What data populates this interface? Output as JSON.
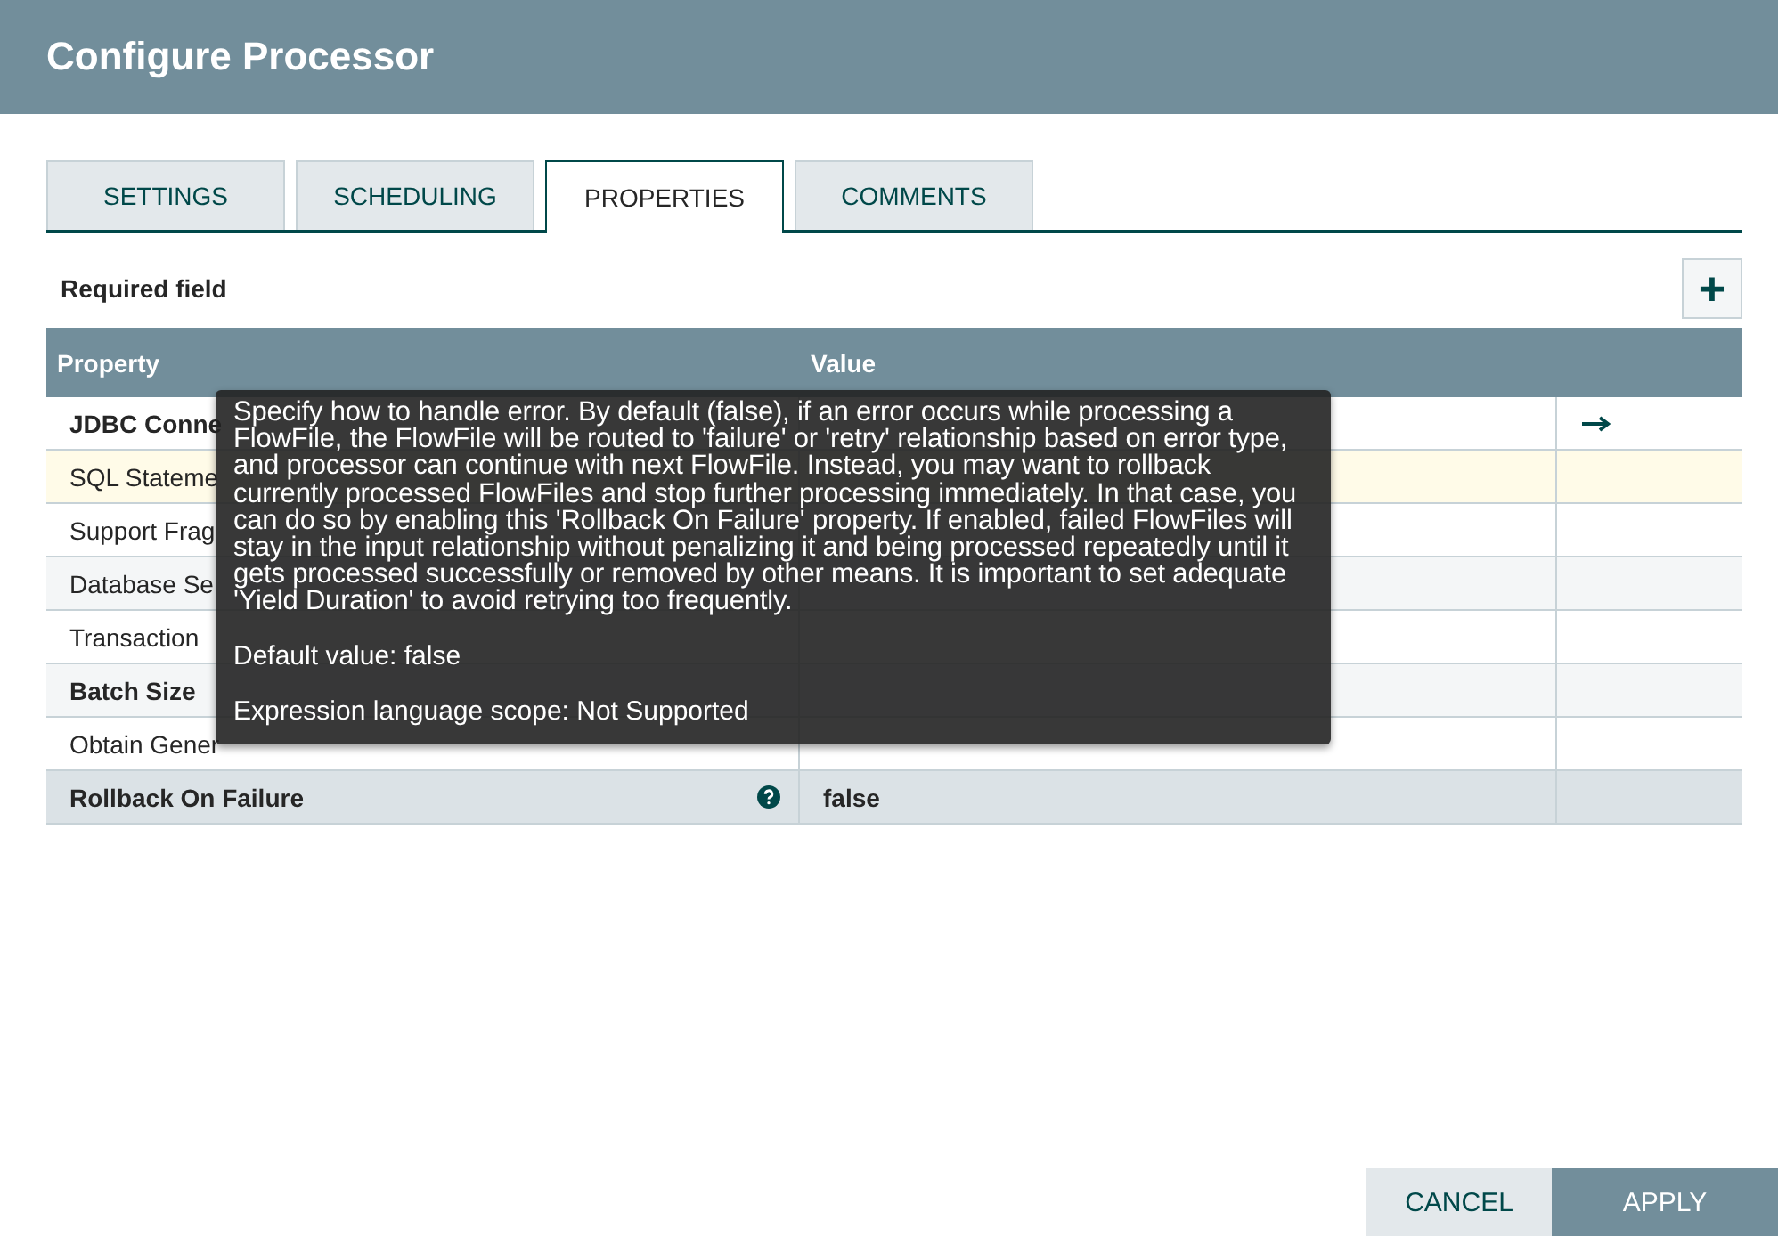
{
  "dialog": {
    "title": "Configure Processor"
  },
  "tabs": [
    {
      "label": "SETTINGS",
      "selected": false
    },
    {
      "label": "SCHEDULING",
      "selected": false
    },
    {
      "label": "PROPERTIES",
      "selected": true
    },
    {
      "label": "COMMENTS",
      "selected": false
    }
  ],
  "required_note": "Required field",
  "add_button": {
    "label": "+"
  },
  "table": {
    "columns": [
      "Property",
      "Value"
    ],
    "rows": [
      {
        "property": "JDBC Conne",
        "value": "",
        "required": true,
        "selected": false,
        "hovered": false,
        "help_icon": false,
        "goto_arrow": true
      },
      {
        "property": "SQL Stateme",
        "value": "",
        "required": false,
        "selected": true,
        "hovered": false,
        "help_icon": false,
        "goto_arrow": false
      },
      {
        "property": "Support Frag",
        "value": "",
        "required": false,
        "selected": false,
        "hovered": false,
        "help_icon": false,
        "goto_arrow": false
      },
      {
        "property": "Database Se",
        "value": "",
        "required": false,
        "selected": false,
        "hovered": false,
        "help_icon": false,
        "goto_arrow": false
      },
      {
        "property": "Transaction",
        "value": "",
        "required": false,
        "selected": false,
        "hovered": false,
        "help_icon": false,
        "goto_arrow": false
      },
      {
        "property": "Batch Size",
        "value": "",
        "required": true,
        "selected": false,
        "hovered": false,
        "help_icon": false,
        "goto_arrow": false
      },
      {
        "property": "Obtain Gener",
        "value": "",
        "required": false,
        "selected": false,
        "hovered": false,
        "help_icon": false,
        "goto_arrow": false
      },
      {
        "property": "Rollback On Failure",
        "value": "false",
        "required": true,
        "selected": false,
        "hovered": true,
        "help_icon": true,
        "goto_arrow": false
      }
    ]
  },
  "tooltip": {
    "description": "Specify how to handle error. By default (false), if an error occurs while processing a FlowFile, the FlowFile will be routed to 'failure' or 'retry' relationship based on error type, and processor can continue with next FlowFile. Instead, you may want to rollback currently processed FlowFiles and stop further processing immediately. In that case, you can do so by enabling this 'Rollback On Failure' property. If enabled, failed FlowFiles will stay in the input relationship without penalizing it and being processed repeatedly until it gets processed successfully or removed by other means. It is important to set adequate 'Yield Duration' to avoid retrying too frequently.",
    "default_value": "Default value: false",
    "expression_scope": "Expression language scope: Not Supported"
  },
  "buttons": [
    {
      "label": "CANCEL",
      "kind": "secondary"
    },
    {
      "label": "APPLY",
      "kind": "primary"
    }
  ]
}
